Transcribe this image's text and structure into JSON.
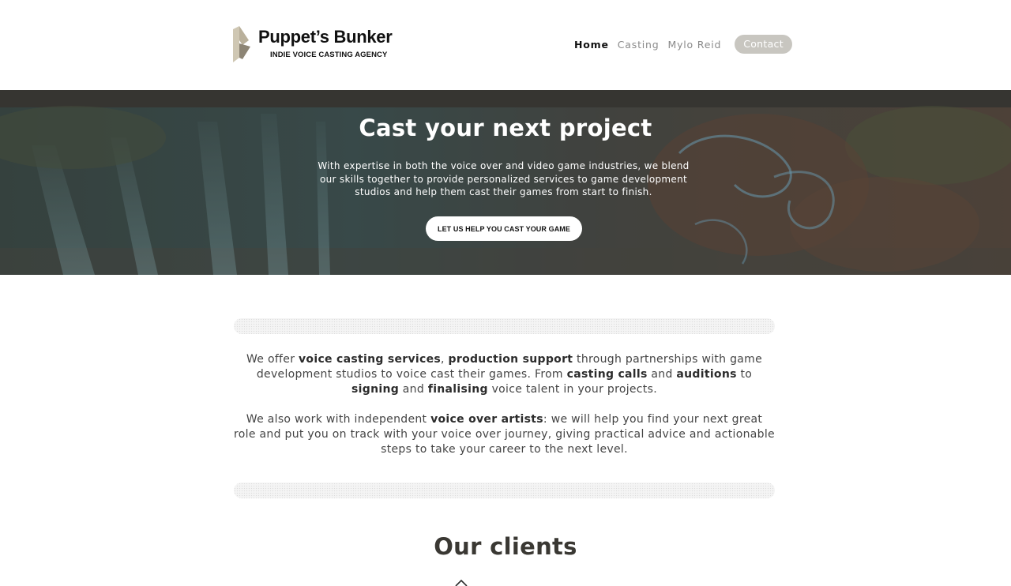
{
  "brand": {
    "name": "Puppet’s Bunker",
    "tagline": "INDIE VOICE CASTING AGENCY",
    "logo_icon": "geometric-folded-shape-logo",
    "colors": {
      "logo_light": "#c9c0ad",
      "logo_dark": "#8d8575"
    }
  },
  "nav": {
    "items": [
      {
        "label": "Home",
        "active": true
      },
      {
        "label": "Casting",
        "active": false
      },
      {
        "label": "Mylo Reid",
        "active": false
      }
    ],
    "contact_label": "Contact"
  },
  "hero": {
    "title": "Cast your next project",
    "text": "With expertise in both the voice over and video game industries, we blend our skills together to provide personalized services to game development studios and help them cast their games from start to finish.",
    "cta_label": "LET US HELP YOU CAST YOUR GAME",
    "background": "dark fantasy game art with tree and waterfall"
  },
  "intro": {
    "p1": [
      {
        "text": "We offer ",
        "bold": false
      },
      {
        "text": "voice casting services",
        "bold": true
      },
      {
        "text": ", ",
        "bold": false
      },
      {
        "text": "production support",
        "bold": true
      },
      {
        "text": " through partnerships with game development studios to voice cast their games. From ",
        "bold": false
      },
      {
        "text": "casting calls",
        "bold": true
      },
      {
        "text": " and ",
        "bold": false
      },
      {
        "text": "auditions",
        "bold": true
      },
      {
        "text": " to ",
        "bold": false
      },
      {
        "text": "signing",
        "bold": true
      },
      {
        "text": " and ",
        "bold": false
      },
      {
        "text": "finalising",
        "bold": true
      },
      {
        "text": " voice talent in your projects.",
        "bold": false
      }
    ],
    "p2": [
      {
        "text": "We also work with independent ",
        "bold": false
      },
      {
        "text": "voice over artists",
        "bold": true
      },
      {
        "text": ": we will help you find your next great role and put you on track with your voice over journey, giving practical advice and actionable steps to take your career to the next level.",
        "bold": false
      }
    ]
  },
  "clients": {
    "title": "Our clients",
    "carousel_icon": "chevron-up-icon"
  }
}
